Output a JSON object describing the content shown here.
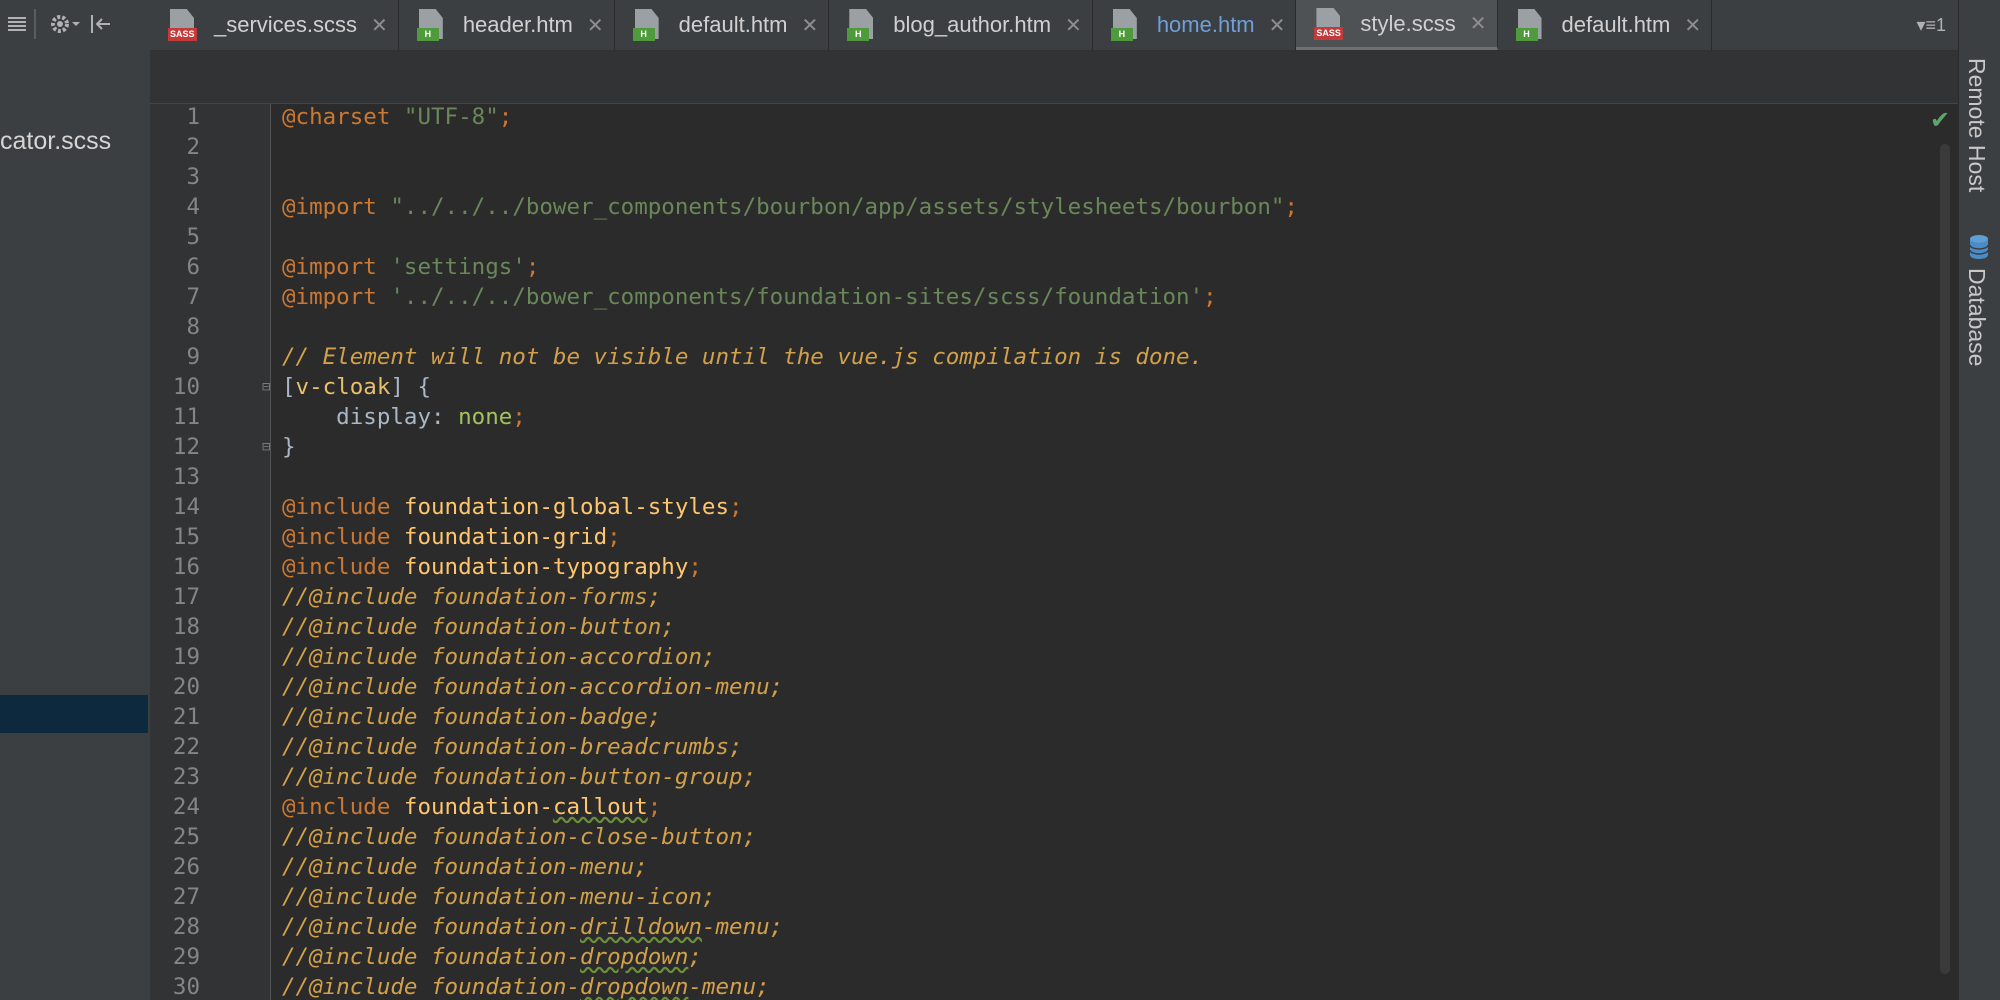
{
  "left_panel": {
    "file_label": "cator.scss",
    "toolbar_icons": [
      "collapse-icon",
      "gear-icon",
      "hide-panel-icon"
    ]
  },
  "tabs": [
    {
      "label": "_services.scss",
      "type": "SASS",
      "active": false,
      "highlight": false
    },
    {
      "label": "header.htm",
      "type": "H",
      "active": false,
      "highlight": false
    },
    {
      "label": "default.htm",
      "type": "H",
      "active": false,
      "highlight": false
    },
    {
      "label": "blog_author.htm",
      "type": "H",
      "active": false,
      "highlight": false
    },
    {
      "label": "home.htm",
      "type": "H",
      "active": false,
      "highlight": true
    },
    {
      "label": "style.scss",
      "type": "SASS",
      "active": true,
      "highlight": false
    },
    {
      "label": "default.htm",
      "type": "H",
      "active": false,
      "highlight": false
    }
  ],
  "tab_overflow": {
    "count": "1"
  },
  "right_bar": {
    "remote_host": "Remote Host",
    "database": "Database"
  },
  "editor": {
    "lines": [
      {
        "n": "1",
        "segs": [
          [
            "at",
            "@charset"
          ],
          [
            "val",
            " "
          ],
          [
            "str",
            "\"UTF-8\""
          ],
          [
            "at",
            ";"
          ]
        ]
      },
      {
        "n": "2",
        "segs": []
      },
      {
        "n": "3",
        "segs": []
      },
      {
        "n": "4",
        "segs": [
          [
            "at",
            "@import"
          ],
          [
            "val",
            " "
          ],
          [
            "str",
            "\"../../../bower_components/bourbon/app/assets/stylesheets/bourbon\""
          ],
          [
            "at",
            ";"
          ]
        ]
      },
      {
        "n": "5",
        "segs": []
      },
      {
        "n": "6",
        "segs": [
          [
            "at",
            "@import"
          ],
          [
            "val",
            " "
          ],
          [
            "str",
            "'settings'"
          ],
          [
            "at",
            ";"
          ]
        ]
      },
      {
        "n": "7",
        "segs": [
          [
            "at",
            "@import"
          ],
          [
            "val",
            " "
          ],
          [
            "str",
            "'../../../bower_components/foundation-sites/scss/foundation'"
          ],
          [
            "at",
            ";"
          ]
        ]
      },
      {
        "n": "8",
        "segs": []
      },
      {
        "n": "9",
        "segs": [
          [
            "cmt",
            "// Element will not be visible until the vue.js compilation is done."
          ]
        ]
      },
      {
        "n": "10",
        "fold": true,
        "segs": [
          [
            "val",
            "["
          ],
          [
            "kw",
            "v-cloak"
          ],
          [
            "val",
            "] {"
          ]
        ]
      },
      {
        "n": "11",
        "segs": [
          [
            "val",
            "    display: "
          ],
          [
            "vbl",
            "none"
          ],
          [
            "at",
            ";"
          ]
        ]
      },
      {
        "n": "12",
        "fold": true,
        "segs": [
          [
            "val",
            "}"
          ]
        ]
      },
      {
        "n": "13",
        "segs": []
      },
      {
        "n": "14",
        "segs": [
          [
            "at",
            "@include"
          ],
          [
            "val",
            " "
          ],
          [
            "mix",
            "foundation-global-styles"
          ],
          [
            "at",
            ";"
          ]
        ]
      },
      {
        "n": "15",
        "segs": [
          [
            "at",
            "@include"
          ],
          [
            "val",
            " "
          ],
          [
            "mix",
            "foundation-grid"
          ],
          [
            "at",
            ";"
          ]
        ]
      },
      {
        "n": "16",
        "segs": [
          [
            "at",
            "@include"
          ],
          [
            "val",
            " "
          ],
          [
            "mix",
            "foundation-typography"
          ],
          [
            "at",
            ";"
          ]
        ]
      },
      {
        "n": "17",
        "segs": [
          [
            "cmt",
            "//@include foundation-forms;"
          ]
        ]
      },
      {
        "n": "18",
        "segs": [
          [
            "cmt",
            "//@include foundation-button;"
          ]
        ]
      },
      {
        "n": "19",
        "segs": [
          [
            "cmt",
            "//@include foundation-accordion;"
          ]
        ]
      },
      {
        "n": "20",
        "segs": [
          [
            "cmt",
            "//@include foundation-accordion-menu;"
          ]
        ]
      },
      {
        "n": "21",
        "segs": [
          [
            "cmt",
            "//@include foundation-badge;"
          ]
        ]
      },
      {
        "n": "22",
        "segs": [
          [
            "cmt",
            "//@include foundation-breadcrumbs;"
          ]
        ]
      },
      {
        "n": "23",
        "segs": [
          [
            "cmt",
            "//@include foundation-button-group;"
          ]
        ]
      },
      {
        "n": "24",
        "segs": [
          [
            "at",
            "@include"
          ],
          [
            "val",
            " "
          ],
          [
            "mix",
            "foundation-"
          ],
          [
            "mix wavy",
            "callout"
          ],
          [
            "at",
            ";"
          ]
        ]
      },
      {
        "n": "25",
        "segs": [
          [
            "cmt",
            "//@include foundation-close-button;"
          ]
        ]
      },
      {
        "n": "26",
        "segs": [
          [
            "cmt",
            "//@include foundation-menu;"
          ]
        ]
      },
      {
        "n": "27",
        "segs": [
          [
            "cmt",
            "//@include foundation-menu-icon;"
          ]
        ]
      },
      {
        "n": "28",
        "segs": [
          [
            "cmt",
            "//@include foundation-"
          ],
          [
            "cmt wavy",
            "drilldown"
          ],
          [
            "cmt",
            "-menu;"
          ]
        ]
      },
      {
        "n": "29",
        "segs": [
          [
            "cmt",
            "//@include foundation-"
          ],
          [
            "cmt wavy",
            "dropdown"
          ],
          [
            "cmt",
            ";"
          ]
        ]
      },
      {
        "n": "30",
        "segs": [
          [
            "cmt",
            "//@include foundation-"
          ],
          [
            "cmt wavy",
            "dropdown"
          ],
          [
            "cmt",
            "-menu;"
          ]
        ]
      }
    ]
  },
  "colors": {
    "editor_bg": "#2b2b2b",
    "at_rule": "#cc7832",
    "string": "#6a8759",
    "comment": "#d2a04a",
    "mixin": "#ffc66d",
    "active_tab_highlight": "#6f9fd8"
  }
}
